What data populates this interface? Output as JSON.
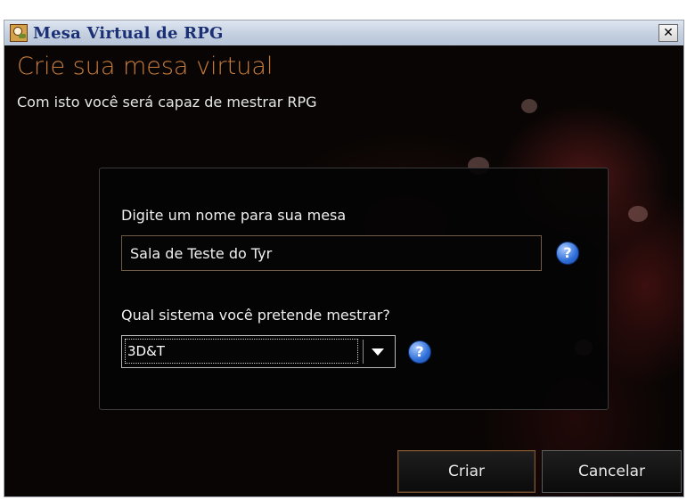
{
  "window": {
    "title": "Mesa Virtual de RPG",
    "close_symbol": "✕"
  },
  "header": {
    "heading": "Crie sua mesa virtual",
    "subheading": "Com isto você será capaz de mestrar RPG"
  },
  "form": {
    "name_label": "Digite um nome para sua mesa",
    "name_value": "Sala de Teste do Tyr",
    "system_label": "Qual sistema você pretende mestrar?",
    "system_selected": "3D&T",
    "help_symbol": "?"
  },
  "buttons": {
    "create": "Criar",
    "cancel": "Cancelar"
  },
  "colors": {
    "heading": "#c87d3d",
    "background": "#080504",
    "title_text": "#1a2f74",
    "help_icon": "#2e6ed8"
  },
  "icons": {
    "app": "app-icon",
    "close": "close-icon",
    "help": "help-icon",
    "dropdown": "chevron-down-icon"
  }
}
